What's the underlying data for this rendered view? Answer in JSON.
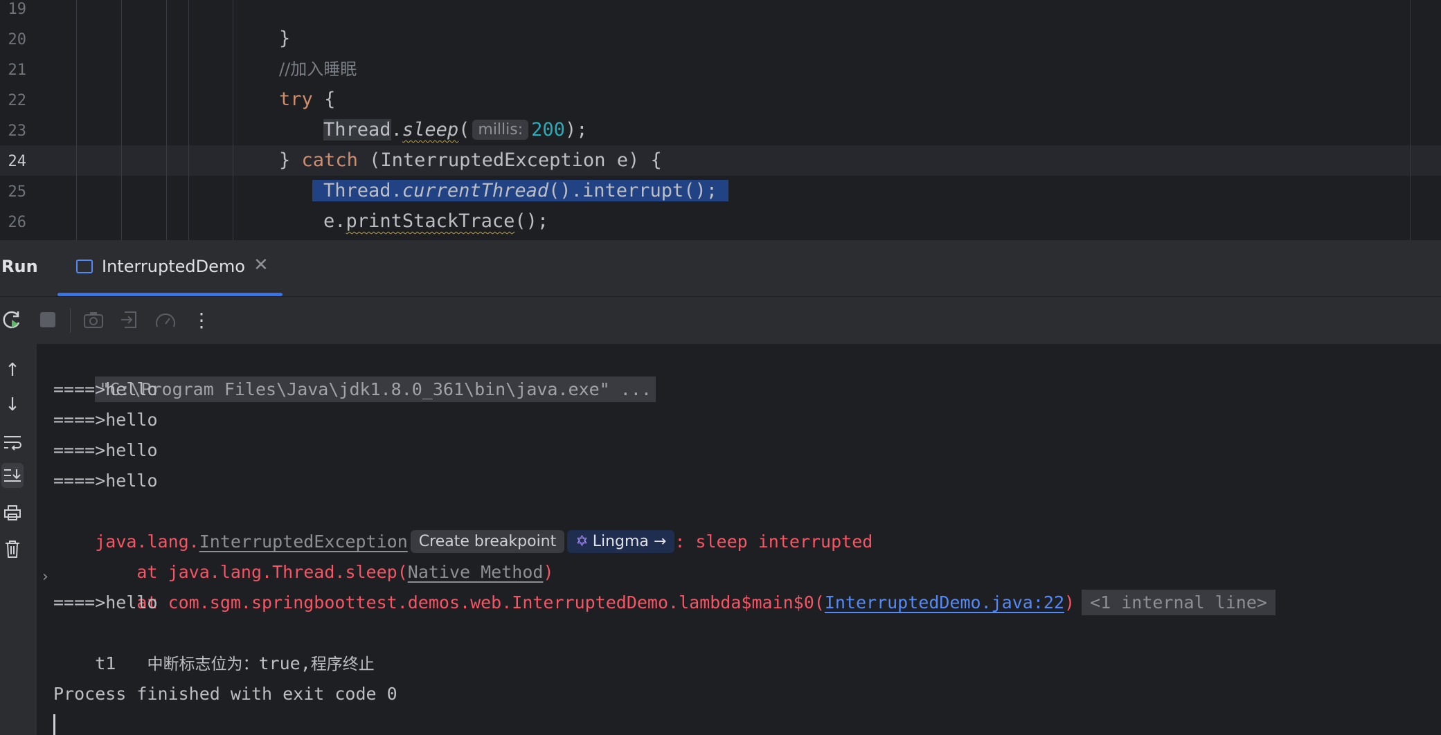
{
  "editor": {
    "lines": [
      {
        "num": "19",
        "text": "}"
      },
      {
        "num": "20",
        "comment": "//加入睡眠"
      },
      {
        "num": "21",
        "kw": "try",
        "rest": " {"
      },
      {
        "num": "22",
        "cls": "Thread",
        "method": "sleep",
        "paren": "(",
        "hint": "millis:",
        "value": "200",
        "tail": ");"
      },
      {
        "num": "23",
        "brace": "} ",
        "kw": "catch",
        "rest": " (InterruptedException e) {"
      },
      {
        "num": "24",
        "cls": "Thread",
        "method": "currentThread",
        "rest": "().interrupt();"
      },
      {
        "num": "25",
        "obj": "e.",
        "method": "printStackTrace",
        "rest": "();"
      },
      {
        "num": "26"
      }
    ]
  },
  "run_panel": {
    "title": "Run",
    "tab_label": "InterruptedDemo",
    "close_icon": "close-icon",
    "toolbar": [
      "rerun-icon",
      "stop-icon",
      "camera-icon",
      "exit-icon",
      "profiler-icon",
      "more-vertical-icon"
    ],
    "side": [
      "scroll-up-icon",
      "scroll-down-icon",
      "soft-wrap-icon",
      "scroll-to-end-icon",
      "print-icon",
      "trash-icon"
    ]
  },
  "console": {
    "cmd": "\"C:\\Program Files\\Java\\jdk1.8.0_361\\bin\\java.exe\" ...",
    "hello": "====>hello",
    "exception_prefix": "java.lang.",
    "exception_class": "InterruptedException",
    "create_breakpoint": "Create breakpoint",
    "lingma": "Lingma",
    "lingma_arrow": "→",
    "exception_msg": ": sleep interrupted",
    "stack1_prefix": "    at java.lang.Thread.sleep(",
    "stack1_link": "Native Method",
    "stack1_suffix": ")",
    "stack2_prefix": "    at com.sgm.springboottest.demos.web.InterruptedDemo.lambda$main$0(",
    "stack2_link": "InterruptedDemo.java:22",
    "stack2_suffix": ")",
    "internal": "<1 internal line>",
    "t1_name": "t1",
    "t1_gap": "   ",
    "t1_text1": "中断标志位为：",
    "t1_true": "true",
    "t1_comma": ",",
    "t1_text2": "程序终止",
    "finished": "Process finished with exit code 0"
  },
  "colors": {
    "background": "#1e1f22",
    "keyword": "#cf8e6d",
    "number": "#2aacb8",
    "error": "#f75464",
    "link": "#548af7",
    "selection": "#214283",
    "accent": "#3574f0"
  }
}
